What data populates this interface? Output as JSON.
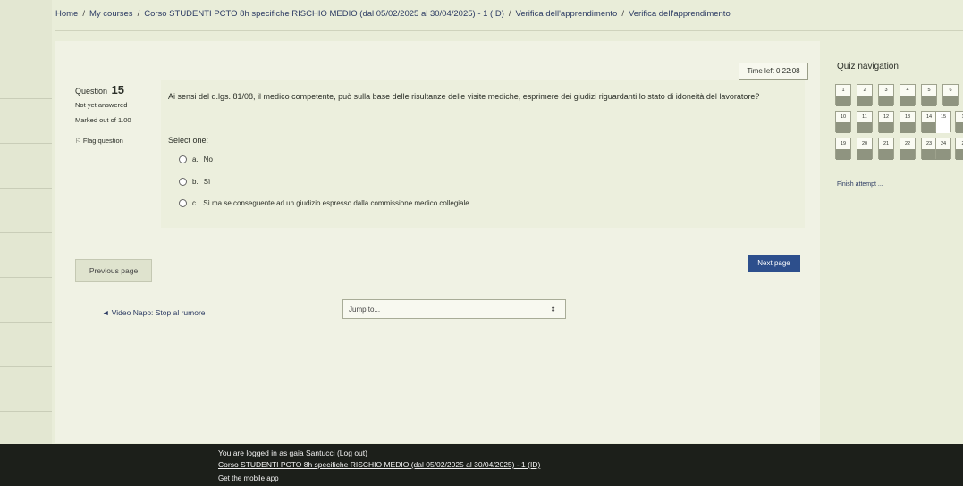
{
  "breadcrumb": [
    "Home",
    "My courses",
    "Corso STUDENTI PCTO 8h specifiche RISCHIO MEDIO (dal 05/02/2025 al 30/04/2025) - 1 (ID)",
    "Verifica dell'apprendimento",
    "Verifica dell'apprendimento"
  ],
  "timer": "Time left 0:22:08",
  "question": {
    "label": "Question",
    "number": "15",
    "status": "Not yet answered",
    "marked": "Marked out of 1.00",
    "flag": "Flag question",
    "text": "Ai sensi del d.lgs. 81/08, il medico competente, può sulla base delle risultanze delle visite mediche, esprimere dei giudizi riguardanti lo stato di idoneità del lavoratore?",
    "select": "Select one:",
    "options": [
      {
        "letter": "a.",
        "text": "No"
      },
      {
        "letter": "b.",
        "text": "Sì"
      },
      {
        "letter": "c.",
        "text": "Sì ma se conseguente ad un giudizio espresso dalla commissione medico collegiale"
      }
    ]
  },
  "nav": {
    "prev": "Previous page",
    "next": "Next page",
    "prev_activity": "◄ Video Napo: Stop al rumore",
    "jump": "Jump to..."
  },
  "quiz_nav": {
    "title": "Quiz navigation",
    "row1": [
      "1",
      "2",
      "3",
      "4",
      "5",
      "6"
    ],
    "row2": [
      "10",
      "11",
      "12",
      "13",
      "14",
      "15",
      "1"
    ],
    "row3": [
      "19",
      "20",
      "21",
      "22",
      "23",
      "24",
      "2"
    ],
    "finish": "Finish attempt ..."
  },
  "footer": {
    "logged": "You are logged in as gaia Santucci (Log out)",
    "course": "Corso STUDENTI PCTO 8h specifiche RISCHIO MEDIO (dal 05/02/2025 al 30/04/2025) - 1 (ID)",
    "app": "Get the mobile app"
  }
}
